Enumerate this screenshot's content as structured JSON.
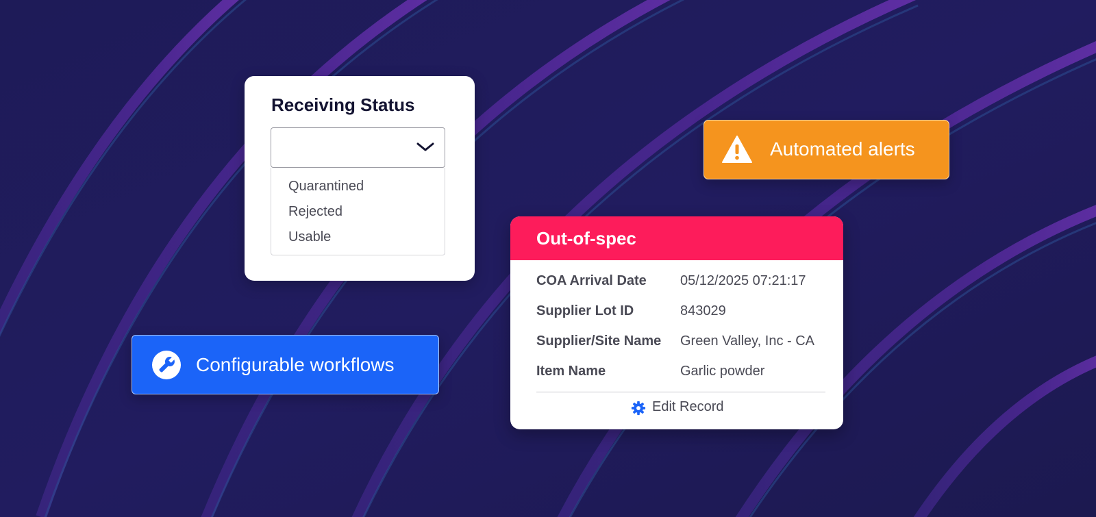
{
  "receiving_status": {
    "title": "Receiving Status",
    "selected_value": "",
    "options": [
      "Quarantined",
      "Rejected",
      "Usable"
    ]
  },
  "alert_badge": {
    "label": "Automated alerts",
    "icon": "warning-icon",
    "color": "#f5941e"
  },
  "workflow_badge": {
    "label": "Configurable workflows",
    "icon": "wrench-icon",
    "color": "#1b64f8"
  },
  "record_card": {
    "title": "Out-of-spec",
    "header_color": "#fd1c5b",
    "fields": [
      {
        "label": "COA Arrival Date",
        "value": "05/12/2025 07:21:17"
      },
      {
        "label": "Supplier Lot ID",
        "value": "843029"
      },
      {
        "label": "Supplier/Site Name",
        "value": "Green Valley, Inc - CA"
      },
      {
        "label": "Item Name",
        "value": "Garlic powder"
      }
    ],
    "edit_label": "Edit Record",
    "edit_icon": "gear-icon",
    "accent_color": "#1b64f8"
  },
  "background": {
    "base_color": "#201b5c",
    "stripe_color": "#5a2a9a"
  }
}
